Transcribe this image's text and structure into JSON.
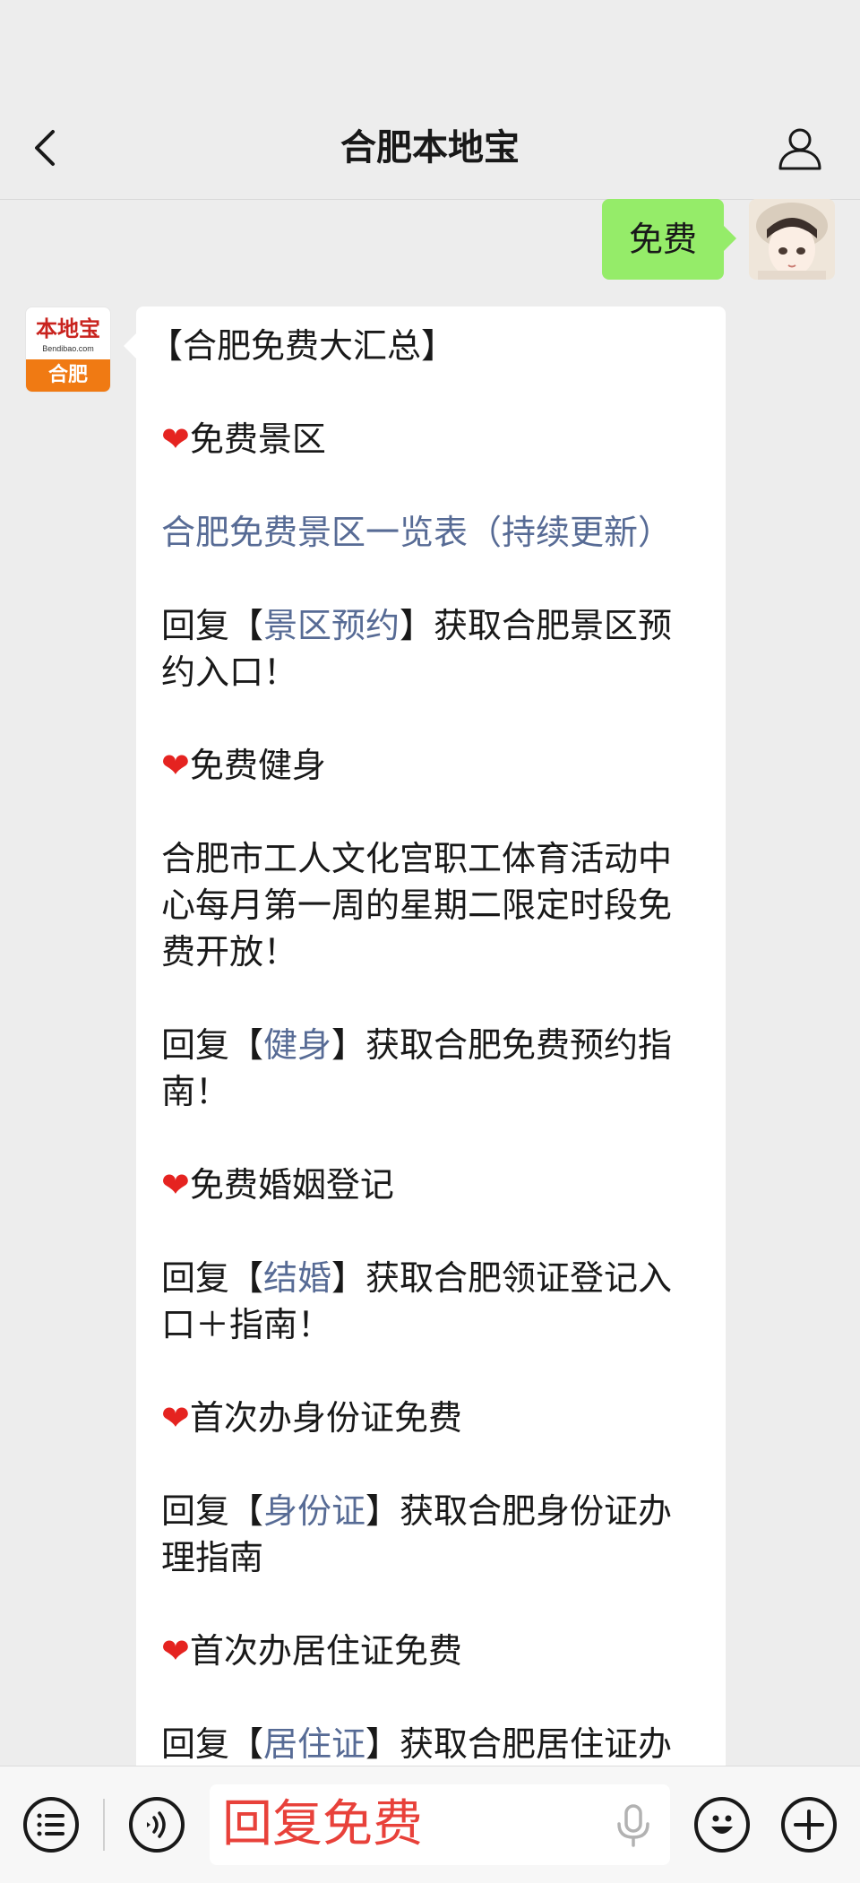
{
  "header": {
    "title": "合肥本地宝",
    "back_icon": "chevron-left-icon",
    "profile_icon": "person-icon"
  },
  "chat": {
    "user_message": "免费",
    "bot_avatar": {
      "logo_text": "本地宝",
      "logo_url": "Bendibao.com",
      "city": "合肥"
    },
    "reply_lines": [
      {
        "type": "title",
        "text": "【合肥免费大汇总】"
      },
      {
        "type": "heading",
        "text": "免费景区"
      },
      {
        "type": "link",
        "text": "合肥免费景区一览表（持续更新）"
      },
      {
        "type": "reply",
        "pre": "回复【",
        "kw": "景区预约",
        "post": "】获取合肥景区预约入口！"
      },
      {
        "type": "heading",
        "text": "免费健身"
      },
      {
        "type": "text",
        "text": "合肥市工人文化宫职工体育活动中心每月第一周的星期二限定时段免费开放！"
      },
      {
        "type": "reply",
        "pre": "回复【",
        "kw": "健身",
        "post": "】获取合肥免费预约指南！"
      },
      {
        "type": "heading",
        "text": "免费婚姻登记"
      },
      {
        "type": "reply",
        "pre": "回复【",
        "kw": "结婚",
        "post": "】获取合肥领证登记入口＋指南！"
      },
      {
        "type": "heading",
        "text": "首次办身份证免费"
      },
      {
        "type": "reply",
        "pre": "回复【",
        "kw": "身份证",
        "post": "】获取合肥身份证办理指南"
      },
      {
        "type": "heading",
        "text": "首次办居住证免费"
      },
      {
        "type": "reply",
        "pre": "回复【",
        "kw": "居住证",
        "post": "】获取合肥居住证办理指南"
      }
    ],
    "heart_glyph": "❤"
  },
  "bottom_bar": {
    "input_value": "回复免费",
    "menu_icon": "menu-list-icon",
    "voice_icon": "voice-icon",
    "mic_icon": "microphone-icon",
    "emoji_icon": "emoji-icon",
    "plus_icon": "plus-icon"
  },
  "colors": {
    "background": "#ededed",
    "user_bubble": "#95ec69",
    "link": "#576b95",
    "heart": "#e52320",
    "input_text": "#e8413a",
    "logo_orange": "#f07a13"
  }
}
